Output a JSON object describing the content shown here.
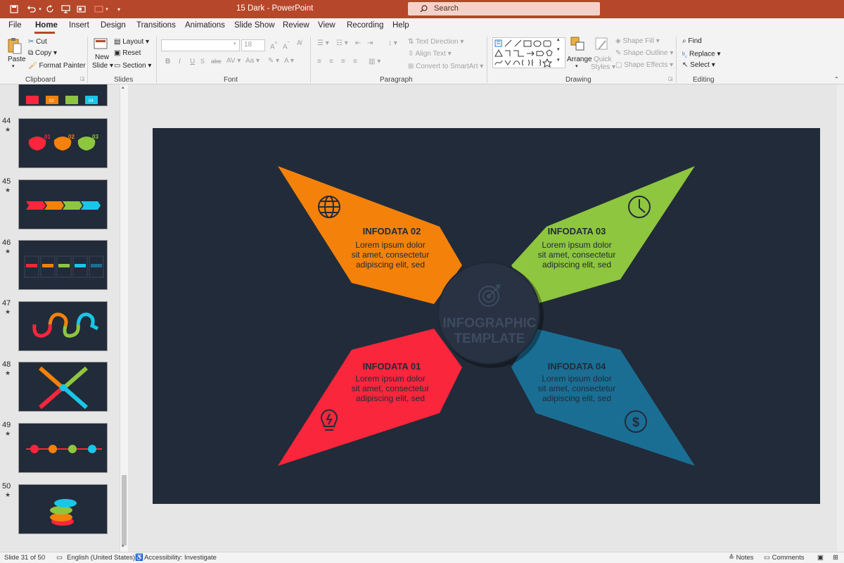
{
  "window": {
    "doc_title": "15 Dark  -  PowerPoint",
    "search_placeholder": "Search"
  },
  "tabs": [
    "File",
    "Home",
    "Insert",
    "Design",
    "Transitions",
    "Animations",
    "Slide Show",
    "Review",
    "View",
    "Recording",
    "Help"
  ],
  "active_tab": "Home",
  "ribbon": {
    "clipboard": {
      "paste": "Paste",
      "cut": "Cut",
      "copy": "Copy",
      "format_painter": "Format Painter",
      "label": "Clipboard"
    },
    "slides": {
      "new_slide_1": "New",
      "new_slide_2": "Slide",
      "layout": "Layout",
      "reset": "Reset",
      "section": "Section",
      "label": "Slides"
    },
    "font": {
      "size": "18",
      "label": "Font",
      "bold": "B",
      "italic": "I",
      "underline": "U",
      "strike": "abc",
      "case": "Aa"
    },
    "paragraph": {
      "text_direction": "Text Direction",
      "align_text": "Align Text",
      "convert_smartart": "Convert to SmartArt",
      "label": "Paragraph"
    },
    "drawing": {
      "arrange": "Arrange",
      "quick_styles_1": "Quick",
      "quick_styles_2": "Styles",
      "shape_fill": "Shape Fill",
      "shape_outline": "Shape Outline",
      "shape_effects": "Shape Effects",
      "label": "Drawing"
    },
    "editing": {
      "find": "Find",
      "replace": "Replace",
      "select": "Select",
      "label": "Editing"
    }
  },
  "thumbnails": [
    {
      "num": "44",
      "labels": [
        "01",
        "02",
        "03"
      ]
    },
    {
      "num": "45"
    },
    {
      "num": "46"
    },
    {
      "num": "47"
    },
    {
      "num": "48"
    },
    {
      "num": "49"
    },
    {
      "num": "50"
    }
  ],
  "top_partial_thumb_labels": [
    "02",
    "04"
  ],
  "slide": {
    "center_title_1": "INFOGRAPHIC",
    "center_title_2": "TEMPLATE",
    "items": [
      {
        "title": "INFODATA 02",
        "l1": "Lorem ipsum dolor",
        "l2": "sit amet, consectetur",
        "l3": "adipiscing elit, sed",
        "color": "#f4820a",
        "icon": "globe-icon"
      },
      {
        "title": "INFODATA 03",
        "l1": "Lorem ipsum dolor",
        "l2": "sit amet, consectetur",
        "l3": "adipiscing elit, sed",
        "color": "#8ec63f",
        "icon": "clock-icon"
      },
      {
        "title": "INFODATA 01",
        "l1": "Lorem ipsum dolor",
        "l2": "sit amet, consectetur",
        "l3": "adipiscing elit, sed",
        "color": "#f9263c",
        "icon": "lightbulb-icon"
      },
      {
        "title": "INFODATA 04",
        "l1": "Lorem ipsum dolor",
        "l2": "sit amet, consectetur",
        "l3": "adipiscing elit, sed",
        "color": "#1a6e94",
        "icon": "dollar-icon"
      }
    ],
    "background": "#222b39"
  },
  "status": {
    "slide_of": "Slide 31 of 50",
    "language": "English (United States)",
    "accessibility": "Accessibility: Investigate",
    "notes": "Notes",
    "comments": "Comments"
  },
  "colors": {
    "accent": "#b7472a"
  }
}
